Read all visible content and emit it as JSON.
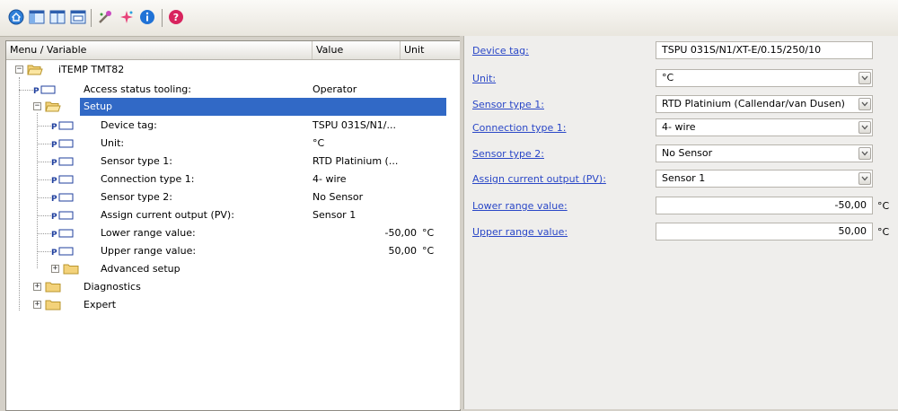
{
  "toolbar": {
    "buttons": [
      "home-icon",
      "panel-left-icon",
      "panel-split-icon",
      "panel-window-icon",
      "tool-wrench-icon",
      "wizard-star-icon",
      "info-icon",
      "help-icon"
    ]
  },
  "tree": {
    "headers": {
      "menu": "Menu / Variable",
      "value": "Value",
      "unit": "Unit"
    },
    "root": "iTEMP TMT82",
    "access": {
      "label": "Access status tooling:",
      "value": "Operator"
    },
    "setup": "Setup",
    "params": [
      {
        "label": "Device tag:",
        "value": "TSPU 031S/N1/...",
        "unit": ""
      },
      {
        "label": "Unit:",
        "value": "°C",
        "unit": ""
      },
      {
        "label": "Sensor type 1:",
        "value": "RTD Platinium (...",
        "unit": ""
      },
      {
        "label": "Connection type 1:",
        "value": "4- wire",
        "unit": ""
      },
      {
        "label": "Sensor type 2:",
        "value": "No Sensor",
        "unit": ""
      },
      {
        "label": "Assign current output (PV):",
        "value": "Sensor 1",
        "unit": ""
      },
      {
        "label": "Lower range value:",
        "value": "-50,00",
        "unit": "°C"
      },
      {
        "label": "Upper range value:",
        "value": "50,00",
        "unit": "°C"
      }
    ],
    "advanced": "Advanced setup",
    "diagnostics": "Diagnostics",
    "expert": "Expert"
  },
  "form": {
    "device_tag": {
      "label": "Device tag:",
      "value": "TSPU 031S/N1/XT-E/0.15/250/10"
    },
    "unit": {
      "label": "Unit:",
      "value": "°C"
    },
    "sensor_type_1": {
      "label": "Sensor type 1:",
      "value": "RTD Platinium (Callendar/van Dusen)"
    },
    "connection_type_1": {
      "label": "Connection type 1:",
      "value": "4- wire"
    },
    "sensor_type_2": {
      "label": "Sensor type 2:",
      "value": "No Sensor"
    },
    "assign_output": {
      "label": "Assign current output (PV):",
      "value": "Sensor 1"
    },
    "lower_range": {
      "label": "Lower range value:",
      "value": "-50,00",
      "unit": "°C"
    },
    "upper_range": {
      "label": "Upper range value:",
      "value": "50,00",
      "unit": "°C"
    }
  },
  "colors": {
    "selection": "#3169c6",
    "link": "#2a47c7"
  }
}
